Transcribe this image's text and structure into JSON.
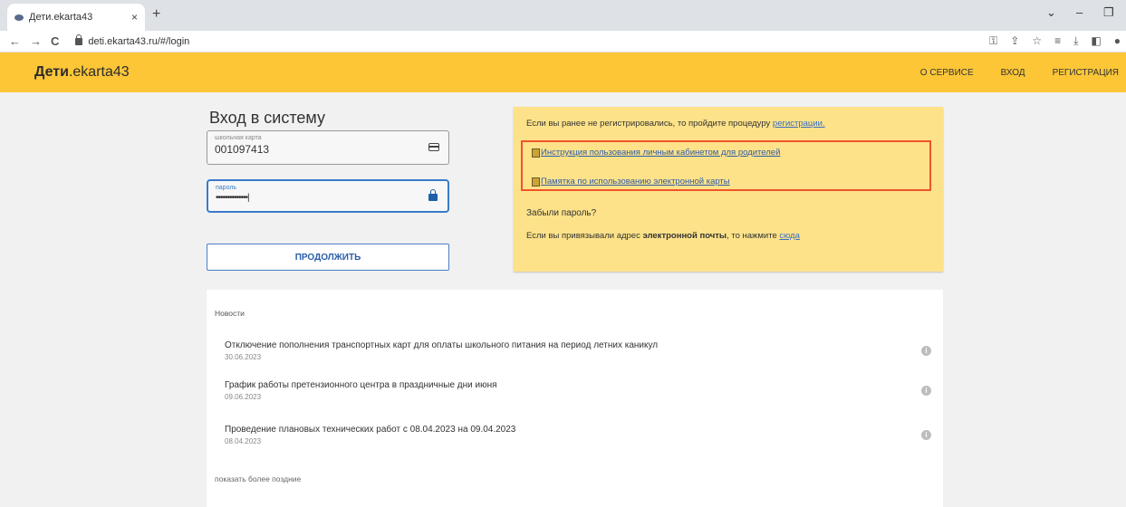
{
  "browser": {
    "tab_title": "Дети.ekarta43",
    "tab_close": "×",
    "new_tab": "+",
    "url": "deti.ekarta43.ru/#/login",
    "back": "←",
    "forward": "→",
    "reload": "C"
  },
  "header": {
    "logo_bold": "Дети",
    "logo_rest": ".ekarta43",
    "nav": [
      "О СЕРВИСЕ",
      "ВХОД",
      "РЕГИСТРАЦИЯ"
    ],
    "bg_color": "#fcc637"
  },
  "login": {
    "title": "Вход в систему",
    "card_label": "школьная карта",
    "card_value": "001097413",
    "password_label": "пароль",
    "password_value": "••••••••••••••|",
    "continue_button": "ПРОДОЛЖИТЬ"
  },
  "info": {
    "register_text": "Если вы ранее не регистрировались, то пройдите процедуру ",
    "register_link": "регистрации.",
    "doc1": "Инструкция пользования личным кабинетом для родителей",
    "doc2": "Памятка по использованию электронной карты",
    "forgot": "Забыли пароль?",
    "email_text_1": "Если вы привязывали адрес ",
    "email_text_bold": "электронной почты",
    "email_text_2": ", то нажмите ",
    "email_link": "сюда"
  },
  "news": {
    "title": "Новости",
    "items": [
      {
        "title": "Отключение пополнения транспортных карт для оплаты школьного питания на период летних каникул",
        "date": "30.06.2023"
      },
      {
        "title": "График работы претензионного центра в праздничные дни июня",
        "date": "09.06.2023"
      },
      {
        "title": "Проведение плановых технических работ с 08.04.2023 на 09.04.2023",
        "date": "08.04.2023"
      }
    ],
    "show_later": "показать более поздние"
  }
}
